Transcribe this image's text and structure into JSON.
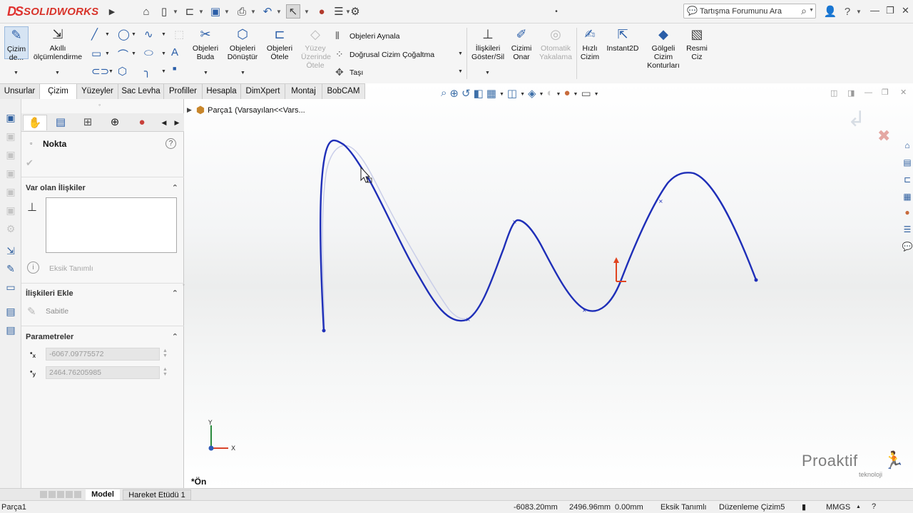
{
  "app": {
    "brand_prefix": "DS",
    "brand_name": "SOLIDWORKS",
    "search_placeholder": "Tartışma Forumunu Ara"
  },
  "ribbon": {
    "sketch_button": "Çizim de...",
    "smart_dimension": "Akıllı ölçümlendirme",
    "trim_entities": "Objeleri Buda",
    "convert_entities": "Objeleri Dönüştür",
    "offset_entities": "Objeleri Ötele",
    "offset_on_surface": "Yüzey Üzerinde Ötele",
    "mirror_entities": "Objeleri Aynala",
    "linear_pattern": "Doğrusal Cizim Çoğaltma",
    "move_entities": "Taşı",
    "display_relations": "İlişkileri Göster/Sil",
    "repair_sketch": "Cizimi Onar",
    "quick_snaps": "Otomatik Yakalama",
    "rapid_sketch": "Hızlı Cizim",
    "instant2d": "Instant2D",
    "shaded_contours": "Gölgeli Cizim Konturları",
    "draw_picture": "Resmi Ciz"
  },
  "tabs": [
    "Unsurlar",
    "Çizim",
    "Yüzeyler",
    "Sac Levha",
    "Profiller",
    "Hesapla",
    "DimXpert",
    "Montaj",
    "BobCAM"
  ],
  "active_tab": "Çizim",
  "panel": {
    "title": "Nokta",
    "existing_relations": "Var olan İlişkiler",
    "status": "Eksik Tanımlı",
    "add_relations": "İlişkileri Ekle",
    "fix_relation": "Sabitle",
    "parameters": "Parametreler",
    "param_x": "-6067.09775572",
    "param_y": "2464.76205985"
  },
  "tree": {
    "part_label": "Parça1  (Varsayılan<<Vars..."
  },
  "viewport": {
    "view_name": "*Ön",
    "triad_x": "X",
    "triad_y": "Y"
  },
  "bottom_tabs": [
    "Model",
    "Hareket Etüdü 1"
  ],
  "status": {
    "part": "Parça1",
    "coord_x": "-6083.20mm",
    "coord_y": "2496.96mm",
    "coord_z": "0.00mm",
    "definition": "Eksik Tanımlı",
    "editing": "Düzenleme Çizim5",
    "units": "MMGS"
  },
  "watermark": {
    "name": "Proaktif",
    "sub": "teknoloji"
  },
  "colors": {
    "spline": "#1f2fb8",
    "spline_ghost": "#c6cbe6",
    "brand_red": "#d8342b",
    "icon_blue": "#2d5e9e"
  }
}
